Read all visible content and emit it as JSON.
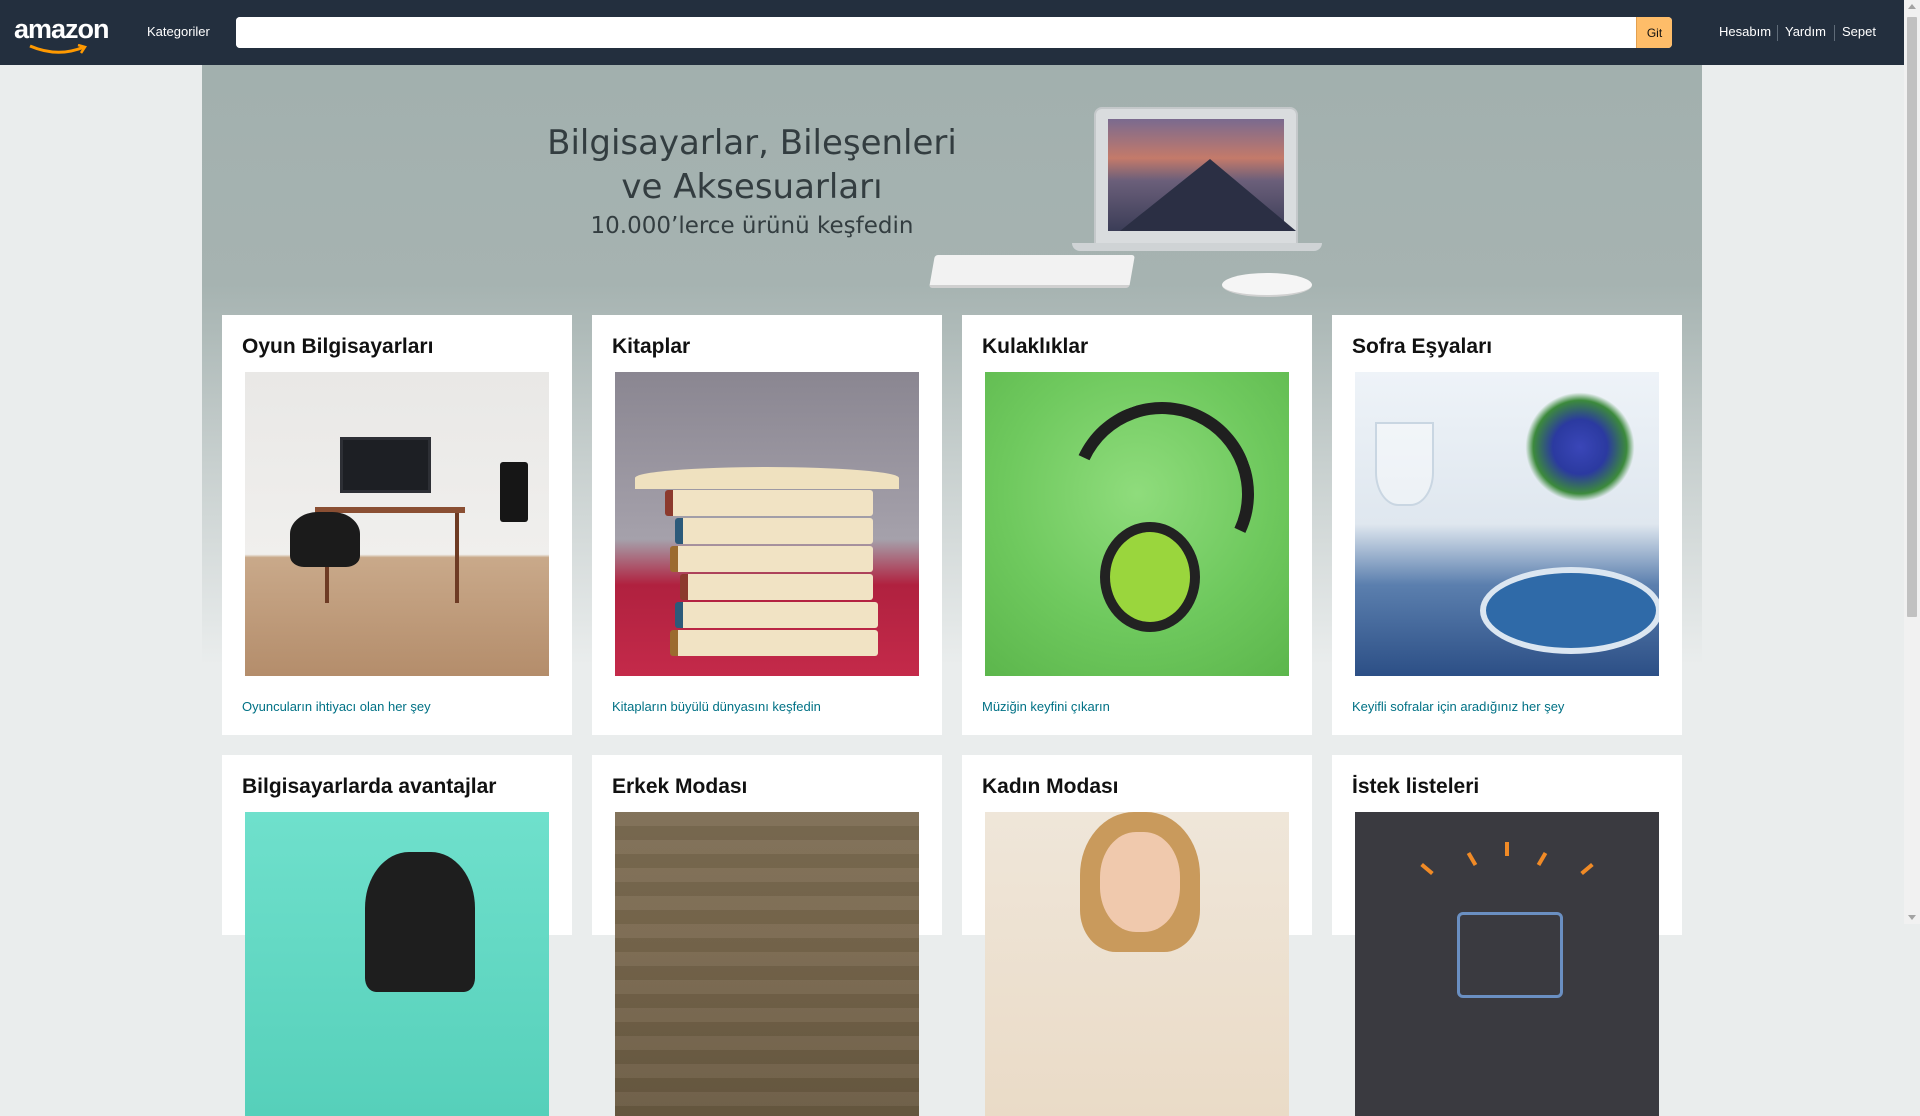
{
  "nav": {
    "logo": "amazon",
    "categories": "Kategoriler",
    "search_placeholder": "",
    "search_button": "Git",
    "account": "Hesabım",
    "help": "Yardım",
    "cart": "Sepet"
  },
  "hero": {
    "title_line1": "Bilgisayarlar, Bileşenleri",
    "title_line2": "ve Aksesuarları",
    "subtitle": "10.000’lerce ürünü keşfedin"
  },
  "cards": [
    {
      "title": "Oyun Bilgisayarları",
      "link": "Oyuncuların ihtiyacı olan her şey"
    },
    {
      "title": "Kitaplar",
      "link": "Kitapların büyülü dünyasını keşfedin"
    },
    {
      "title": "Kulaklıklar",
      "link": "Müziğin keyfini çıkarın"
    },
    {
      "title": "Sofra Eşyaları",
      "link": "Keyifli sofralar için aradığınız her şey"
    },
    {
      "title": "Bilgisayarlarda avantajlar"
    },
    {
      "title": "Erkek Modası"
    },
    {
      "title": "Kadın Modası"
    },
    {
      "title": "İstek listeleri"
    }
  ],
  "colors": {
    "nav_bg": "#232f3e",
    "search_button_bg": "#febd69",
    "link": "#007185",
    "page_bg": "#eaeded"
  }
}
